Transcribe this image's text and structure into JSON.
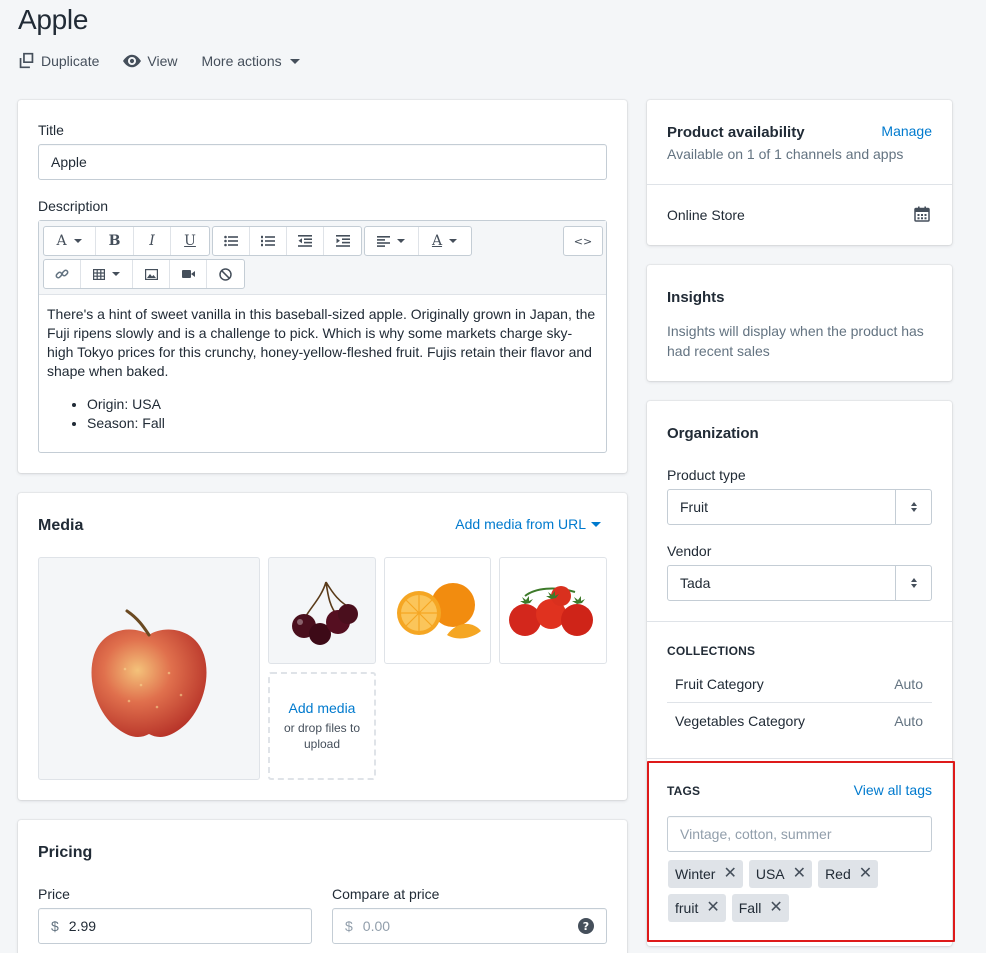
{
  "page": {
    "title": "Apple"
  },
  "actions": [
    {
      "label": "Duplicate",
      "icon": "duplicate-icon"
    },
    {
      "label": "View",
      "icon": "eye-icon"
    },
    {
      "label": "More actions",
      "icon": "caret-down-icon"
    }
  ],
  "details": {
    "title_label": "Title",
    "title_value": "Apple",
    "description_label": "Description",
    "description_paragraph": "There's a hint of sweet vanilla in this baseball-sized apple. Originally grown in Japan, the Fuji ripens slowly and is a challenge to pick. Which is why some markets charge sky-high Tokyo prices for this crunchy, honey-yellow-fleshed fruit. Fujis retain their flavor and shape when baked.",
    "description_bullets": [
      "Origin: USA",
      "Season: Fall"
    ]
  },
  "editor_toolbar": {
    "font_glyph": "A",
    "bold_glyph": "B",
    "italic_glyph": "I",
    "underline_glyph": "U",
    "color_glyph": "A",
    "html_glyph": "<>"
  },
  "media": {
    "heading": "Media",
    "add_url_link": "Add media from URL",
    "images": [
      "apple",
      "cherries",
      "oranges",
      "tomatoes"
    ],
    "dropzone_link": "Add media",
    "dropzone_hint": "or drop files to upload"
  },
  "pricing": {
    "heading": "Pricing",
    "price_label": "Price",
    "price_currency": "$",
    "price_value": "2.99",
    "compare_label": "Compare at price",
    "compare_currency": "$",
    "compare_placeholder": "0.00"
  },
  "availability": {
    "heading": "Product availability",
    "manage_link": "Manage",
    "subtitle": "Available on 1 of 1 channels and apps",
    "channel": "Online Store"
  },
  "insights": {
    "heading": "Insights",
    "text": "Insights will display when the product has had recent sales"
  },
  "organization": {
    "heading": "Organization",
    "product_type_label": "Product type",
    "product_type_value": "Fruit",
    "vendor_label": "Vendor",
    "vendor_value": "Tada",
    "collections_heading": "COLLECTIONS",
    "collections": [
      {
        "name": "Fruit Category",
        "status": "Auto"
      },
      {
        "name": "Vegetables Category",
        "status": "Auto"
      }
    ],
    "tags_heading": "TAGS",
    "view_all_tags_link": "View all tags",
    "tags_placeholder": "Vintage, cotton, summer",
    "tags": [
      "Winter",
      "USA",
      "Red",
      "fruit",
      "Fall"
    ]
  },
  "colors": {
    "link": "#007ace",
    "highlight": "#de1a1a",
    "background": "#f4f6f8"
  }
}
